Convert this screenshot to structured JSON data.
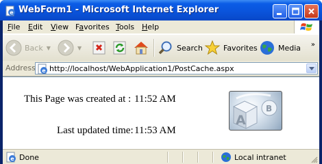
{
  "window": {
    "title": "WebForm1 - Microsoft Internet Explorer"
  },
  "menu": {
    "items": [
      {
        "label": "File",
        "accel": "F",
        "rest": "ile"
      },
      {
        "label": "Edit",
        "accel": "E",
        "rest": "dit"
      },
      {
        "label": "View",
        "accel": "V",
        "rest": "iew"
      },
      {
        "label": "Favorites",
        "accel": "a",
        "pre": "F",
        "rest": "vorites"
      },
      {
        "label": "Tools",
        "accel": "T",
        "rest": "ools"
      },
      {
        "label": "Help",
        "accel": "H",
        "rest": "elp"
      }
    ]
  },
  "toolbar": {
    "back": "Back",
    "search": "Search",
    "favorites": "Favorites",
    "media": "Media",
    "overflow": "»"
  },
  "address": {
    "label": "Address",
    "url": "http://localhost/WebApplication1/PostCache.aspx"
  },
  "page": {
    "created_label": "This Page was created at :",
    "created_time": "11:52 AM",
    "updated_label": "Last updated time:",
    "updated_time": "11:53 AM"
  },
  "status": {
    "text": "Done",
    "zone": "Local intranet"
  },
  "colors": {
    "titlebar": "#0a54dc",
    "chrome": "#ece9d8",
    "address_border": "#7f9db9"
  }
}
